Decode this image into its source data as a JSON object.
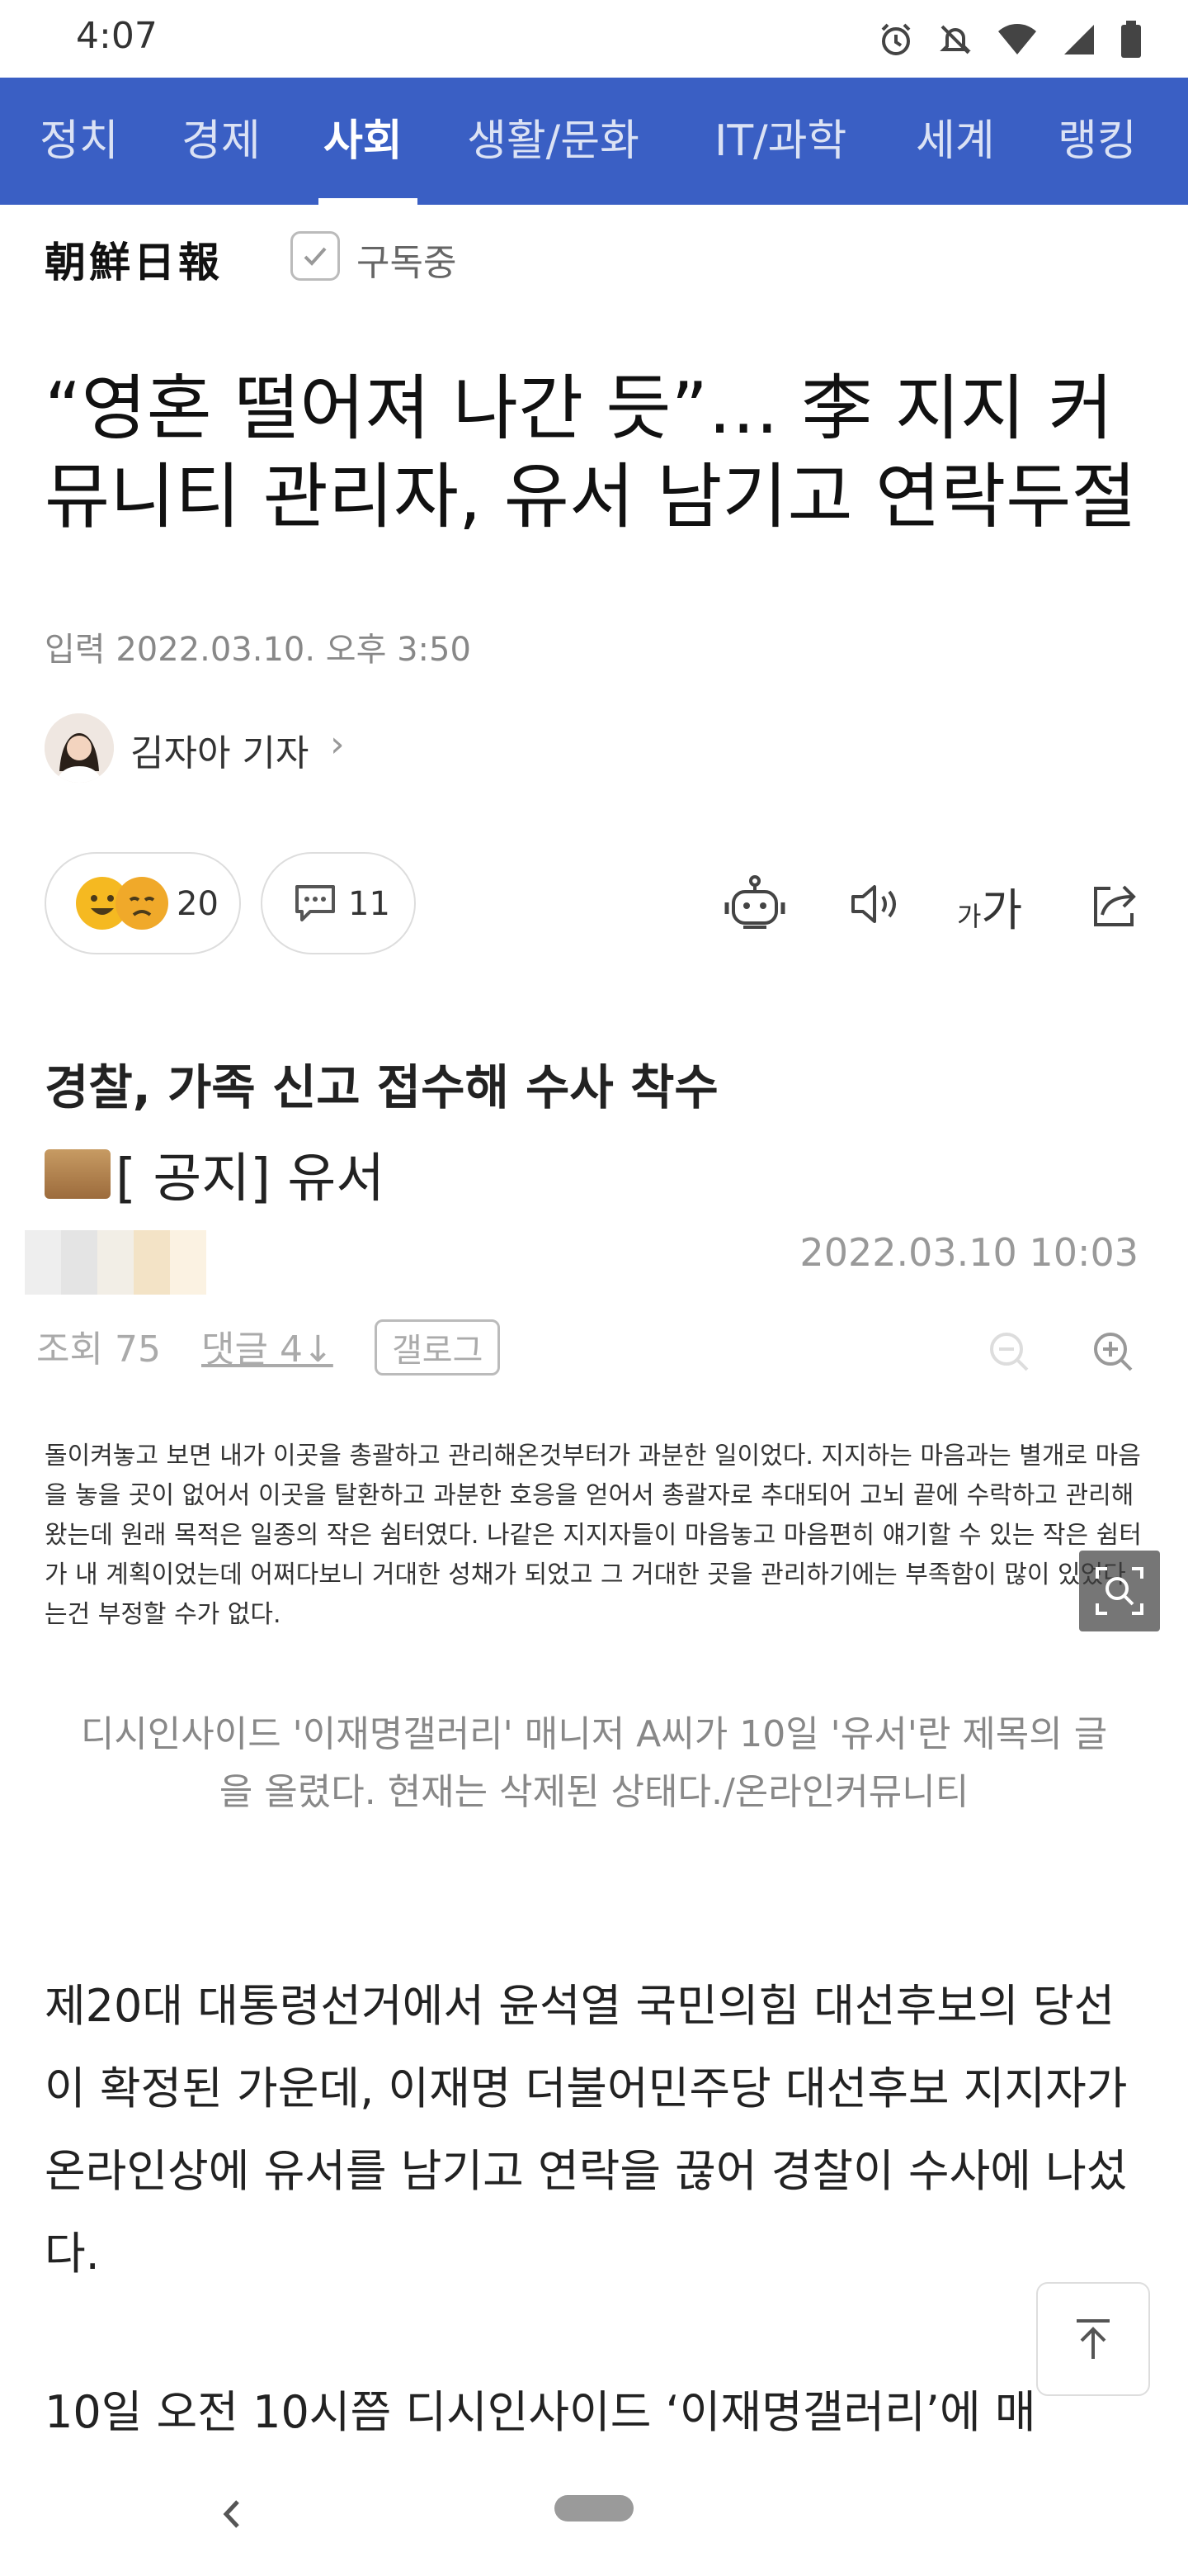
{
  "status_bar": {
    "time": "4:07",
    "icons": [
      "alarm-icon",
      "mute-icon",
      "wifi-icon",
      "signal-icon",
      "battery-icon"
    ]
  },
  "nav": {
    "items": [
      {
        "label": "정치",
        "active": false
      },
      {
        "label": "경제",
        "active": false
      },
      {
        "label": "사회",
        "active": true
      },
      {
        "label": "생활/문화",
        "active": false
      },
      {
        "label": "IT/과학",
        "active": false
      },
      {
        "label": "세계",
        "active": false
      },
      {
        "label": "랭킹",
        "active": false
      }
    ],
    "bg_color": "#3a5fc4"
  },
  "publisher": {
    "name": "朝鮮日報",
    "subscribe_label": "구독중"
  },
  "article": {
    "headline": "“영혼 떨어져 나간 듯”… 李 지지 커뮤니티 관리자, 유서 남기고 연락두절",
    "date": "입력 2022.03.10. 오후 3:50",
    "author": "김자아 기자",
    "reactions": {
      "count": "20"
    },
    "comments": {
      "count": "11"
    },
    "font_tool": {
      "small": "가",
      "large": "가"
    },
    "subhead": "경찰, 가족 신고 접수해 수사 착수",
    "embedded_post": {
      "title": "[ 공지] 유서",
      "date": "2022.03.10 10:03",
      "views": "조회 75",
      "comments": "댓글 4↓",
      "gallog": "갤로그",
      "body": "돌이켜놓고 보면 내가 이곳을 총괄하고 관리해온것부터가 과분한 일이었다. 지지하는 마음과는 별개로 마음을 놓을 곳이 없어서 이곳을 탈환하고 과분한 호응을 얻어서 총괄자로 추대되어 고뇌 끝에 수락하고 관리해왔는데 원래 목적은 일종의 작은 쉼터였다. 나같은 지지자들이 마음놓고 마음편히 얘기할 수 있는 작은 쉼터가 내 계획이었는데 어쩌다보니 거대한 성채가 되었고 그 거대한 곳을 관리하기에는 부족함이 많이 있었다는건 부정할 수가 없다."
    },
    "caption": "디시인사이드 '이재명갤러리' 매니저 A씨가 10일 '유서'란 제목의 글을 올렸다. 현재는 삭제된 상태다./온라인커뮤니티",
    "paragraph1": "제20대 대통령선거에서 윤석열 국민의힘 대선후보의 당선이 확정된 가운데, 이재명 더불어민주당 대선후보 지지자가 온라인상에 유서를 남기고 연락을 끊어 경찰이 수사에 나섰다.",
    "paragraph2": "10일 오전 10시쯤 디시인사이드 ‘이재명갤러리’에 매"
  }
}
